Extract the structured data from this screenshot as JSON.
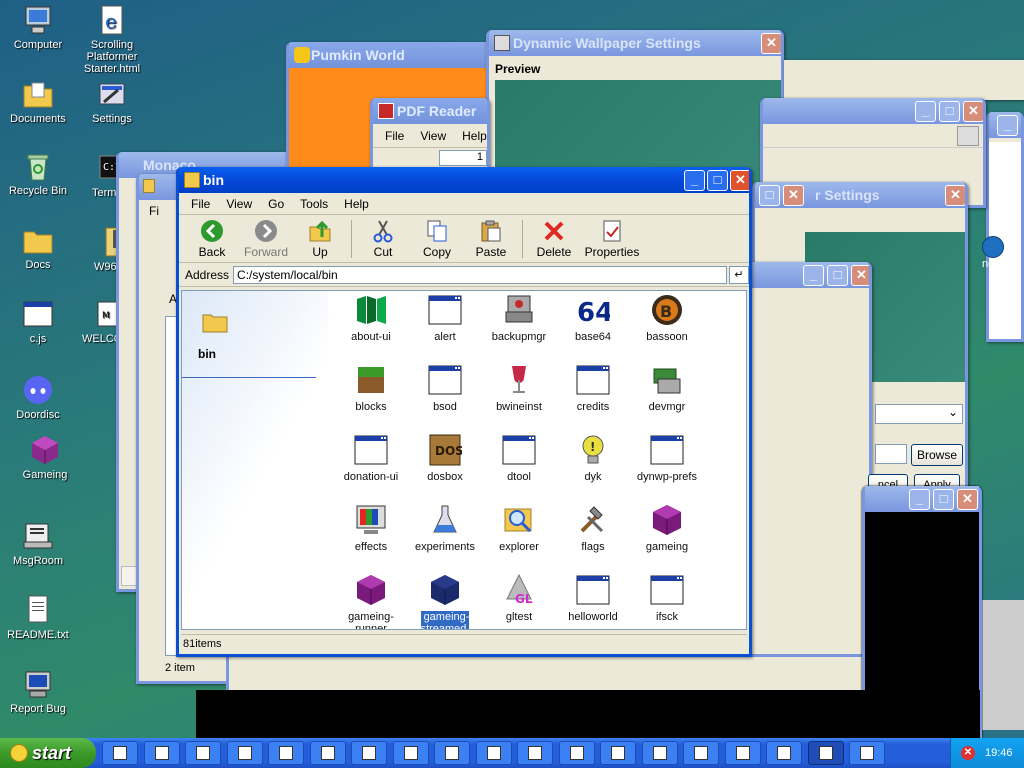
{
  "desktop": {
    "icons": [
      {
        "label": "Computer",
        "icon": "computer-icon"
      },
      {
        "label": "Scrolling Platformer Starter.html",
        "icon": "ie-document-icon"
      },
      {
        "label": "Documents",
        "icon": "documents-folder-icon"
      },
      {
        "label": "Settings",
        "icon": "settings-icon"
      },
      {
        "label": "Recycle Bin",
        "icon": "recycle-bin-icon"
      },
      {
        "label": "Term",
        "icon": "terminal-icon"
      },
      {
        "label": "Docs",
        "icon": "folder-icon"
      },
      {
        "label": "W96",
        "icon": "zip-icon"
      },
      {
        "label": "c.js",
        "icon": "window-file-icon"
      },
      {
        "label": "WELCO",
        "icon": "welcome-icon"
      },
      {
        "label": "Doordisc",
        "icon": "discord-icon"
      },
      {
        "label": "Gameing",
        "icon": "purple-cube-icon"
      },
      {
        "label": "MsgRoom",
        "icon": "msgroom-icon"
      },
      {
        "label": "README.txt",
        "icon": "text-file-icon"
      },
      {
        "label": "Report Bug",
        "icon": "report-bug-icon"
      }
    ]
  },
  "background_windows": {
    "pumkin": {
      "title": "Pumkin World"
    },
    "wallpaper": {
      "title": "Dynamic Wallpaper Settings",
      "preview_label": "Preview",
      "browse_label": "Browse",
      "cancel_label": "ncel",
      "apply_label": "Apply"
    },
    "pdf": {
      "title": "PDF Reader",
      "menu": [
        "File",
        "View",
        "Help"
      ],
      "page": "1"
    },
    "monaco": {
      "title": "Monaco"
    },
    "settings2": {
      "title": "r Settings"
    },
    "left_fragments": {
      "fi": "Fi",
      "a": "A",
      "items": "2 item"
    },
    "right_fragment": {
      "netE": "netE"
    }
  },
  "explorer": {
    "title": "bin",
    "menu": [
      "File",
      "View",
      "Go",
      "Tools",
      "Help"
    ],
    "toolbar": [
      {
        "label": "Back",
        "icon": "back-arrow-icon"
      },
      {
        "label": "Forward",
        "icon": "forward-arrow-icon"
      },
      {
        "label": "Up",
        "icon": "up-folder-icon"
      },
      {
        "label": "Cut",
        "icon": "scissors-icon"
      },
      {
        "label": "Copy",
        "icon": "copy-icon"
      },
      {
        "label": "Paste",
        "icon": "paste-icon"
      },
      {
        "label": "Delete",
        "icon": "delete-x-icon"
      },
      {
        "label": "Properties",
        "icon": "properties-icon"
      }
    ],
    "address_label": "Address",
    "address_value": "C:/system/local/bin",
    "side_folder_label": "bin",
    "status": "81items",
    "files": [
      {
        "label": "about-ui",
        "icon": "about-ui-icon"
      },
      {
        "label": "alert",
        "icon": "window-app-icon"
      },
      {
        "label": "backupmgr",
        "icon": "backup-icon"
      },
      {
        "label": "base64",
        "icon": "base64-icon"
      },
      {
        "label": "bassoon",
        "icon": "bassoon-icon"
      },
      {
        "label": "blocks",
        "icon": "grass-block-icon"
      },
      {
        "label": "bsod",
        "icon": "window-app-icon"
      },
      {
        "label": "bwineinst",
        "icon": "wine-glass-icon"
      },
      {
        "label": "credits",
        "icon": "window-app-icon"
      },
      {
        "label": "devmgr",
        "icon": "device-manager-icon"
      },
      {
        "label": "donation-ui",
        "icon": "window-app-icon"
      },
      {
        "label": "dosbox",
        "icon": "dosbox-icon"
      },
      {
        "label": "dtool",
        "icon": "window-app-icon"
      },
      {
        "label": "dyk",
        "icon": "lightbulb-icon"
      },
      {
        "label": "dynwp-prefs",
        "icon": "window-app-icon"
      },
      {
        "label": "effects",
        "icon": "effects-icon"
      },
      {
        "label": "experiments",
        "icon": "flask-icon"
      },
      {
        "label": "explorer",
        "icon": "explorer-magnifier-icon"
      },
      {
        "label": "flags",
        "icon": "tools-icon"
      },
      {
        "label": "gameing",
        "icon": "purple-cube-icon"
      },
      {
        "label": "gameing-runner",
        "icon": "purple-cube-icon"
      },
      {
        "label": "gameing-streamed",
        "icon": "blue-cube-icon"
      },
      {
        "label": "gltest",
        "icon": "gl-cone-icon"
      },
      {
        "label": "helloworld",
        "icon": "window-app-icon"
      },
      {
        "label": "ifsck",
        "icon": "window-app-icon"
      }
    ],
    "selected_index": 21
  },
  "taskbar": {
    "start_label": "start",
    "clock": "19:46",
    "task_count": 19,
    "active_task": 17
  }
}
